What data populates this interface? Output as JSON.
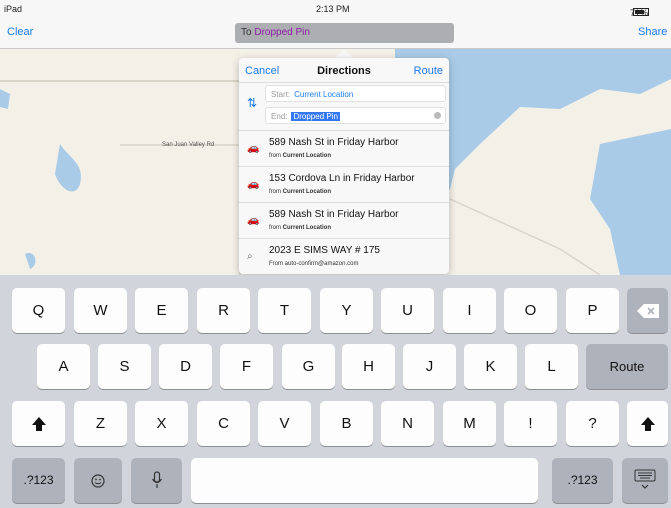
{
  "status": {
    "device": "iPad",
    "time": "2:13 PM",
    "battery": "71%"
  },
  "navbar": {
    "clear": "Clear",
    "route_prefix": "To",
    "route_dest": "Dropped Pin",
    "share": "Share"
  },
  "map": {
    "road_label": "San Juan Valley Rd"
  },
  "directions": {
    "cancel": "Cancel",
    "title": "Directions",
    "route": "Route",
    "start_label": "Start:",
    "start_value": "Current Location",
    "end_label": "End:",
    "end_value": "Dropped Pin",
    "results": [
      {
        "icon": "car-icon",
        "title": "589 Nash St in Friday Harbor",
        "from_prefix": "from",
        "from": "Current Location"
      },
      {
        "icon": "car-icon",
        "title": "153 Cordova Ln in Friday Harbor",
        "from_prefix": "from",
        "from": "Current Location"
      },
      {
        "icon": "car-icon",
        "title": "589 Nash St in Friday Harbor",
        "from_prefix": "from",
        "from": "Current Location"
      },
      {
        "icon": "search-icon",
        "title": "2023 E SIMS WAY # 175",
        "from_prefix": "From",
        "from": "auto-confirm@amazon.com"
      }
    ]
  },
  "keyboard": {
    "row1": [
      "Q",
      "W",
      "E",
      "R",
      "T",
      "Y",
      "U",
      "I",
      "O",
      "P"
    ],
    "row2": [
      "A",
      "S",
      "D",
      "F",
      "G",
      "H",
      "J",
      "K",
      "L"
    ],
    "row3": [
      "Z",
      "X",
      "C",
      "V",
      "B",
      "N",
      "M",
      "!",
      "?"
    ],
    "return_label": "Route",
    "num_label": ".?123"
  },
  "colors": {
    "accent": "#1a7cf0",
    "selection": "#3478f6",
    "destination": "#8e1ca6",
    "keyboard_bg": "#d1d5db"
  }
}
